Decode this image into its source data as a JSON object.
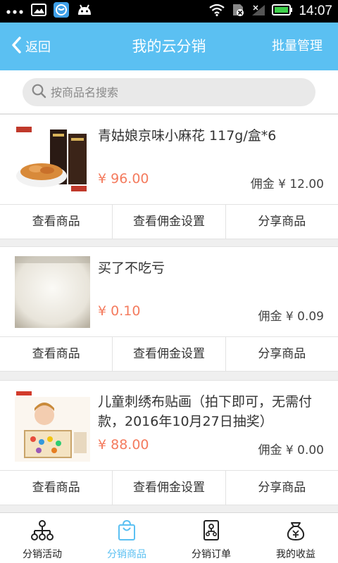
{
  "status_bar": {
    "time": "14:07"
  },
  "header": {
    "back_label": "返回",
    "title": "我的云分销",
    "batch_label": "批量管理"
  },
  "search": {
    "placeholder": "按商品名搜索"
  },
  "products": [
    {
      "name": "青姑娘京味小麻花 117g/盒*6",
      "price": "¥ 96.00",
      "commission": "佣金 ¥ 12.00",
      "image": "snack-box-image"
    },
    {
      "name": "买了不吃亏",
      "price": "¥ 0.10",
      "commission": "佣金 ¥ 0.09",
      "image": "rice-image"
    },
    {
      "name": "儿童刺绣布贴画（拍下即可，无需付款，2016年10月27日抽奖）",
      "price": "¥ 88.00",
      "commission": "佣金 ¥ 0.00",
      "image": "child-craft-image"
    }
  ],
  "actions": {
    "view_product": "查看商品",
    "view_commission": "查看佣金设置",
    "share_product": "分享商品"
  },
  "tabs": [
    {
      "label": "分销活动",
      "icon": "org-chart-icon",
      "active": false
    },
    {
      "label": "分销商品",
      "icon": "shopping-bag-icon",
      "active": true
    },
    {
      "label": "分销订单",
      "icon": "order-doc-icon",
      "active": false
    },
    {
      "label": "我的收益",
      "icon": "money-bag-icon",
      "active": false
    }
  ],
  "colors": {
    "primary": "#5bc0f2",
    "price": "#f47b5e",
    "background": "#efefef"
  }
}
